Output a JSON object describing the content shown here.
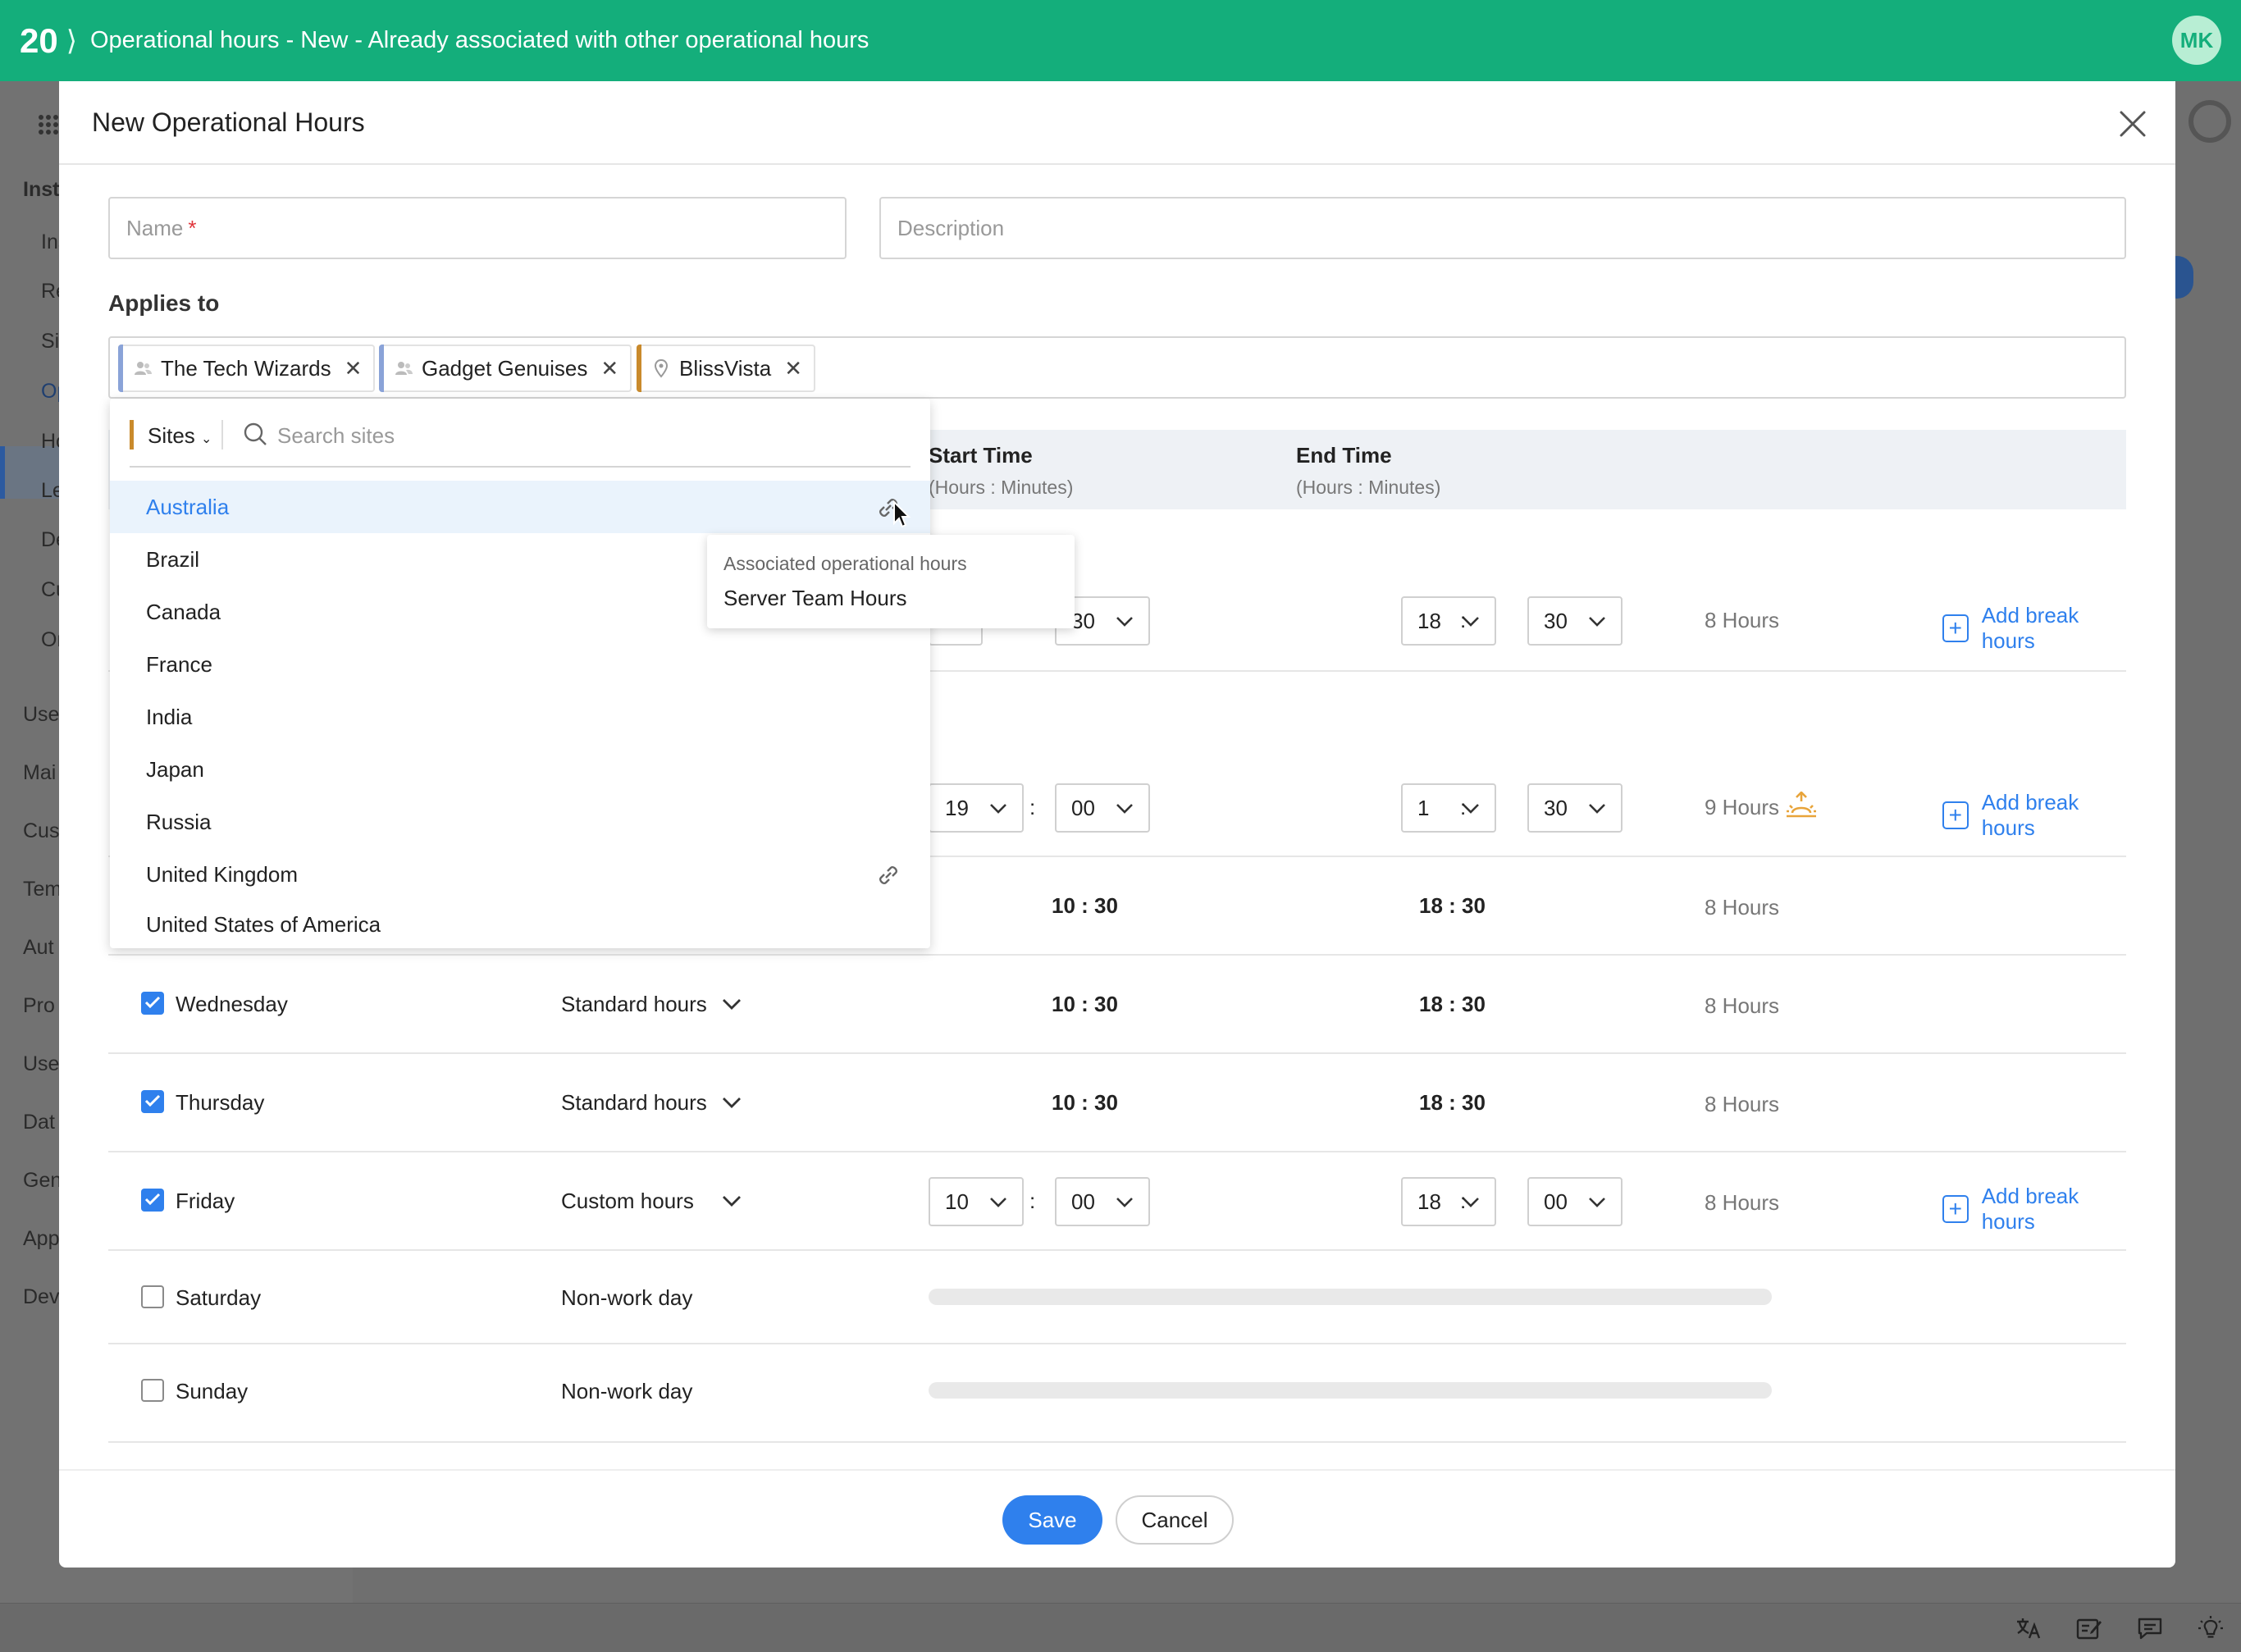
{
  "topbar": {
    "count": "20",
    "title": "Operational hours - New - Already associated with other operational hours",
    "avatar_initials": "MK"
  },
  "background_nav": {
    "items": [
      "Inst",
      "Ins",
      "Re",
      "Sit",
      "Op",
      "Ho",
      "Le",
      "De",
      "Cu",
      "Or",
      "Use",
      "Mai",
      "Cus",
      "Tem",
      "Aut",
      "Pro",
      "Use",
      "Dat",
      "Gen",
      "App",
      "Dev"
    ]
  },
  "modal": {
    "title": "New Operational Hours",
    "name_placeholder": "Name",
    "name_required_mark": "*",
    "description_placeholder": "Description",
    "applies_to_label": "Applies to",
    "chips": [
      {
        "label": "The Tech Wizards",
        "icon": "group-icon",
        "color": "#8aa3d8"
      },
      {
        "label": "Gadget Genuises",
        "icon": "group-icon",
        "color": "#8aa3d8"
      },
      {
        "label": "BlissVista",
        "icon": "location-pin-icon",
        "color": "#c98a2c"
      }
    ],
    "table": {
      "start_time_label": "Start Time",
      "end_time_label": "End Time",
      "time_hint": "(Hours : Minutes)"
    },
    "rows": [
      {
        "start_min": "30",
        "end_hour": "18",
        "end_min": "30",
        "duration": "8 Hours",
        "add_break": "Add break hours"
      },
      {
        "start_hour": "19",
        "start_min": "00",
        "end_hour": "1",
        "end_min": "30",
        "duration": "9 Hours",
        "add_break": "Add break hours"
      },
      {
        "start": "10 : 30",
        "end": "18 : 30",
        "duration": "8 Hours"
      },
      {
        "day": "Wednesday",
        "checked": true,
        "type": "Standard hours",
        "start": "10 : 30",
        "end": "18 : 30",
        "duration": "8 Hours"
      },
      {
        "day": "Thursday",
        "checked": true,
        "type": "Standard hours",
        "start": "10 : 30",
        "end": "18 : 30",
        "duration": "8 Hours"
      },
      {
        "day": "Friday",
        "checked": true,
        "type": "Custom hours",
        "start_hour": "10",
        "start_min": "00",
        "end_hour": "18",
        "end_min": "00",
        "duration": "8 Hours",
        "add_break": "Add break hours"
      },
      {
        "day": "Saturday",
        "checked": false,
        "type": "Non-work day"
      },
      {
        "day": "Sunday",
        "checked": false,
        "type": "Non-work day"
      }
    ],
    "colon": ":",
    "dropdown": {
      "filter_label": "Sites",
      "search_placeholder": "Search sites",
      "items": [
        "Australia",
        "Brazil",
        "Canada",
        "France",
        "India",
        "Japan",
        "Russia",
        "United Kingdom",
        "United States of America"
      ],
      "tooltip_title": "Associated operational hours",
      "tooltip_value": "Server Team Hours"
    },
    "save_label": "Save",
    "cancel_label": "Cancel"
  },
  "colors": {
    "topbar": "#14ae7b",
    "accent": "#2f80ed",
    "site_chip": "#c98a2c",
    "group_chip": "#8aa3d8"
  }
}
